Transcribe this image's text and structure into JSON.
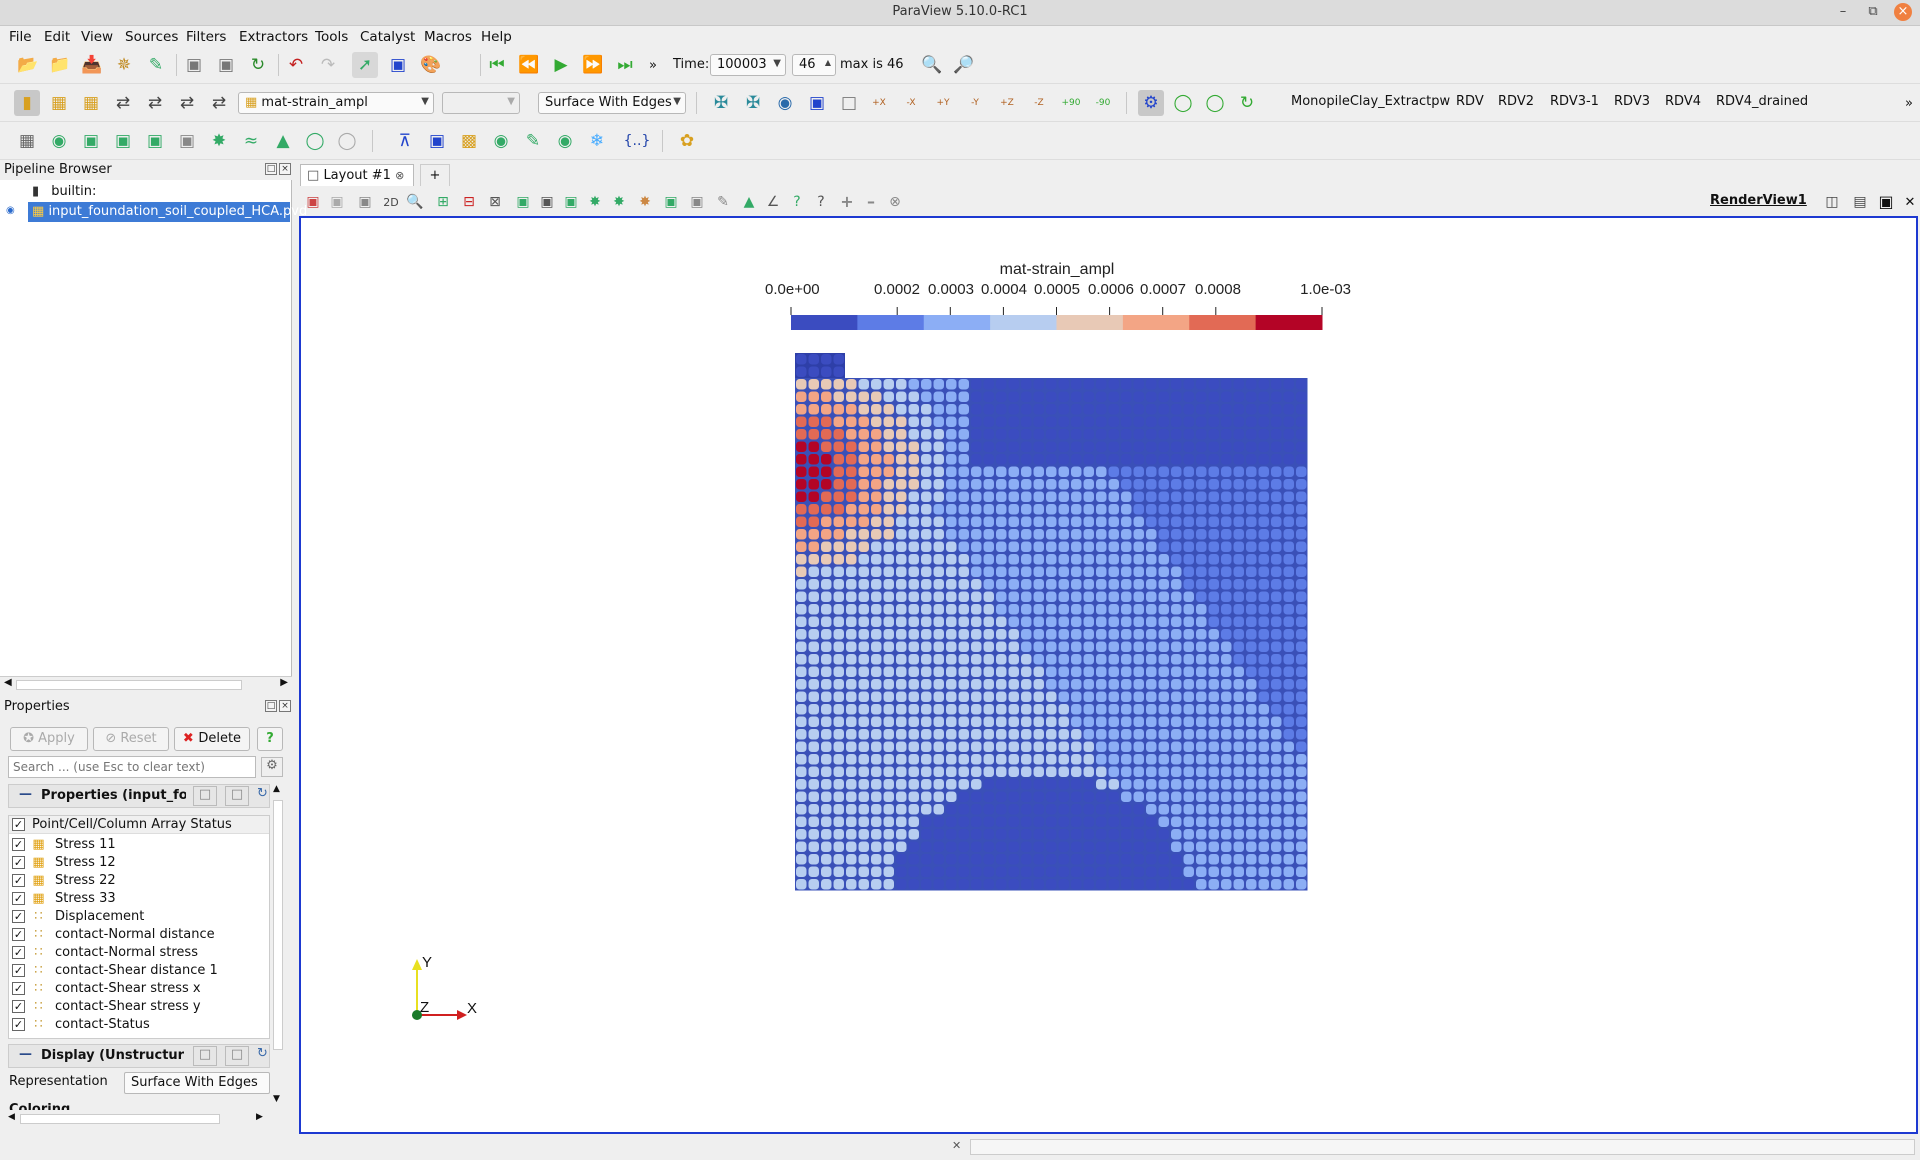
{
  "window": {
    "title": "ParaView 5.10.0-RC1"
  },
  "menu": [
    "File",
    "Edit",
    "View",
    "Sources",
    "Filters",
    "Extractors",
    "Tools",
    "Catalyst",
    "Macros",
    "Help"
  ],
  "time_toolbar": {
    "time_label": "Time:",
    "time_value": "100003",
    "timestep": "46",
    "max_label": "max is 46"
  },
  "display_toolbar": {
    "array": "mat-strain_ampl",
    "component": "",
    "representation": "Surface With Edges"
  },
  "camera_links": [
    "MonopileClay_Extractpw",
    "RDV",
    "RDV2",
    "RDV3-1",
    "RDV3",
    "RDV4",
    "RDV4_drained"
  ],
  "camera_icon_labels": [
    "+X",
    "-X",
    "+Y",
    "-Y",
    "+Z",
    "-Z",
    "+90",
    "-90"
  ],
  "pipeline": {
    "title": "Pipeline Browser",
    "root": "builtin:",
    "items": [
      {
        "label": "input_foundation_soil_coupled_HCA.pvd",
        "selected": true
      }
    ]
  },
  "properties": {
    "title": "Properties",
    "apply": "Apply",
    "reset": "Reset",
    "delete": "Delete",
    "help": "?",
    "search_placeholder": "Search ... (use Esc to clear text)",
    "section1": "Properties (input_fo",
    "array_header": "Point/Cell/Column Array Status",
    "arrays": [
      {
        "label": "Stress 11",
        "kind": "cell"
      },
      {
        "label": "Stress 12",
        "kind": "cell"
      },
      {
        "label": "Stress 22",
        "kind": "cell"
      },
      {
        "label": "Stress 33",
        "kind": "cell"
      },
      {
        "label": "Displacement",
        "kind": "point"
      },
      {
        "label": "contact-Normal distance",
        "kind": "point"
      },
      {
        "label": "contact-Normal stress",
        "kind": "point"
      },
      {
        "label": "contact-Shear distance 1",
        "kind": "point"
      },
      {
        "label": "contact-Shear stress x",
        "kind": "point"
      },
      {
        "label": "contact-Shear stress y",
        "kind": "point"
      },
      {
        "label": "contact-Status",
        "kind": "point"
      }
    ],
    "section2": "Display (Unstructur",
    "representation_label": "Representation",
    "representation_value": "Surface With Edges",
    "coloring_label": "Coloring"
  },
  "layout": {
    "tab": "Layout #1",
    "add": "+",
    "view_name": "RenderView1",
    "btn_2d": "2D"
  },
  "colorbar": {
    "title": "mat-strain_ampl",
    "labels": [
      "0.0e+00",
      "0.0002",
      "0.0003",
      "0.0004",
      "0.0005",
      "0.0006",
      "0.0007",
      "0.0008",
      "1.0e-03"
    ],
    "range": [
      0,
      0.001
    ],
    "bins": [
      "#3b4cc0",
      "#5d7ce6",
      "#8caef5",
      "#b7cdf0",
      "#e8c9b6",
      "#f3a585",
      "#e26a55",
      "#b40426"
    ]
  },
  "axes": {
    "y": "Y",
    "z": "Z",
    "x": "X"
  },
  "colors": {
    "selection": "#3d7bd6",
    "view_border": "#1d39d1"
  }
}
